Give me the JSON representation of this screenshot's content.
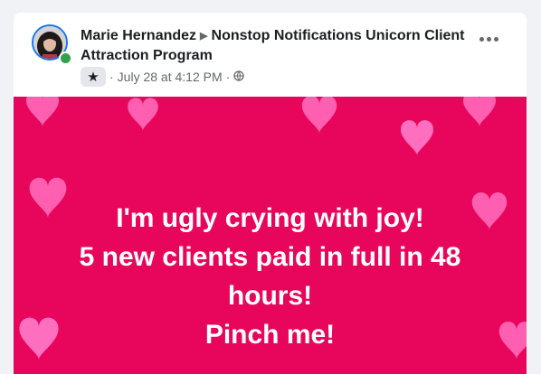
{
  "post": {
    "author": "Marie Hernandez",
    "group": "Nonstop Notifications Unicorn Client Attraction Program",
    "timestamp": "July 28 at 4:12 PM",
    "separator": "·",
    "badge_icon": "star-badge-icon",
    "audience_icon": "globe-icon",
    "more_icon": "more-options-icon",
    "status": "online",
    "text_lines": [
      "I'm ugly crying with joy!",
      "5 new clients paid in full in 48",
      "hours!",
      "Pinch me!"
    ],
    "background_color": "#e8065c",
    "text_color": "#ffffff",
    "accent_color": "#1877f2"
  }
}
